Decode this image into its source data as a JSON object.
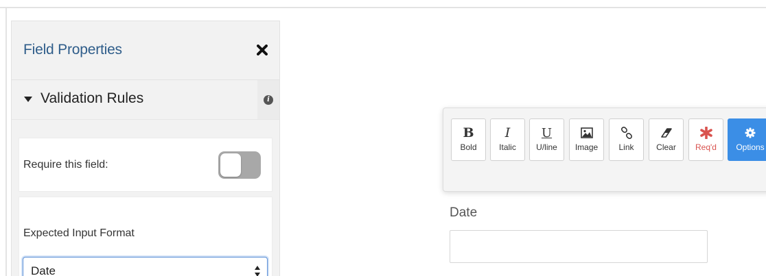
{
  "panel": {
    "title": "Field Properties",
    "close_icon": "close-icon",
    "section": {
      "title": "Validation Rules",
      "expanded": true,
      "caret_icon": "caret-down-icon",
      "info_icon": "info-icon",
      "info_glyph": "i"
    },
    "require_field": {
      "label": "Require this field:",
      "enabled": false
    },
    "input_format": {
      "label": "Expected Input Format",
      "selected": "Date"
    }
  },
  "toolbar": {
    "buttons": [
      {
        "id": "bold",
        "label": "Bold",
        "glyph": "B",
        "icon": "bold-icon"
      },
      {
        "id": "italic",
        "label": "Italic",
        "glyph": "I",
        "icon": "italic-icon"
      },
      {
        "id": "underline",
        "label": "U/line",
        "glyph": "U",
        "icon": "underline-icon"
      },
      {
        "id": "image",
        "label": "Image",
        "icon": "image-icon"
      },
      {
        "id": "link",
        "label": "Link",
        "icon": "link-icon"
      },
      {
        "id": "clear",
        "label": "Clear",
        "icon": "eraser-icon"
      },
      {
        "id": "required",
        "label": "Req'd",
        "icon": "asterisk-icon"
      },
      {
        "id": "options",
        "label": "Options",
        "icon": "gear-icon"
      }
    ]
  },
  "preview": {
    "field_label": "Date",
    "field_value": ""
  },
  "colors": {
    "panel_title": "#2f5d8a",
    "options_button": "#3b8ee6",
    "required_button": "#d9534f",
    "select_focus_border": "#5b8fd6",
    "toggle_off": "#a8a8a8"
  }
}
